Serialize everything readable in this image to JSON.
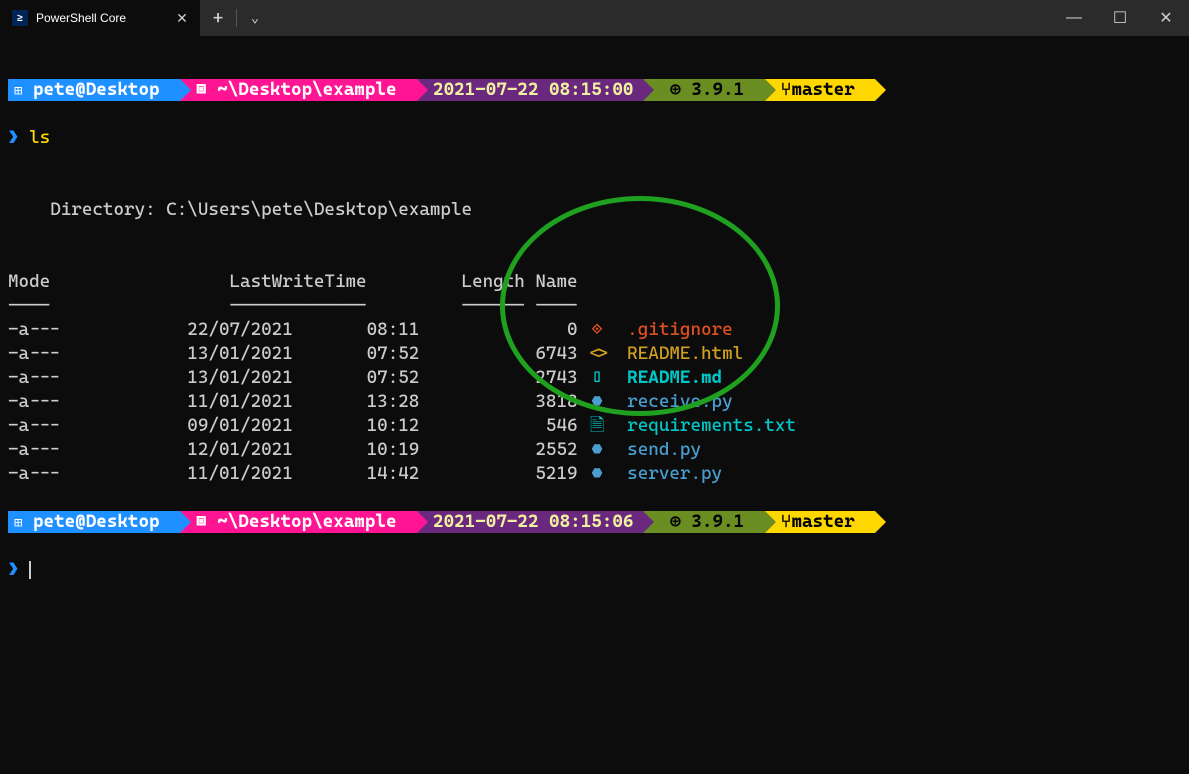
{
  "window": {
    "tab_title": "PowerShell Core",
    "minimize": "—",
    "maximize": "☐",
    "close": "✕"
  },
  "powerline1": {
    "user": "pete@Desktop",
    "path": "~\\Desktop\\example",
    "time": "2021-07-22 08:15:00",
    "python": "3.9.1",
    "git": "master"
  },
  "command": "ls",
  "directory_label": "    Directory: C:\\Users\\pete\\Desktop\\example",
  "table": {
    "headers": {
      "mode": "Mode",
      "lwt": "LastWriteTime",
      "len": "Length",
      "name": "Name"
    },
    "rows": [
      {
        "mode": "-a---",
        "date": "22/07/2021",
        "time": "08:11",
        "len": "0",
        "icon": "◈",
        "name": ".gitignore",
        "cls": "git"
      },
      {
        "mode": "-a---",
        "date": "13/01/2021",
        "time": "07:52",
        "len": "6743",
        "icon": "<>",
        "name": "README.html",
        "cls": "html"
      },
      {
        "mode": "-a---",
        "date": "13/01/2021",
        "time": "07:52",
        "len": "2743",
        "icon": "▯",
        "name": "README.md",
        "cls": "md"
      },
      {
        "mode": "-a---",
        "date": "11/01/2021",
        "time": "13:28",
        "len": "3818",
        "icon": "⬣",
        "name": "receive.py",
        "cls": "py"
      },
      {
        "mode": "-a---",
        "date": "09/01/2021",
        "time": "10:12",
        "len": "546",
        "icon": "🗎",
        "name": "requirements.txt",
        "cls": "txt"
      },
      {
        "mode": "-a---",
        "date": "12/01/2021",
        "time": "10:19",
        "len": "2552",
        "icon": "⬣",
        "name": "send.py",
        "cls": "py"
      },
      {
        "mode": "-a---",
        "date": "11/01/2021",
        "time": "14:42",
        "len": "5219",
        "icon": "⬣",
        "name": "server.py",
        "cls": "py"
      }
    ]
  },
  "powerline2": {
    "user": "pete@Desktop",
    "path": "~\\Desktop\\example",
    "time": "2021-07-22 08:15:06",
    "python": "3.9.1",
    "git": "master"
  },
  "icons": {
    "win": "⊞",
    "folder": "📁",
    "py": "⊕",
    "branch": "⑂"
  }
}
